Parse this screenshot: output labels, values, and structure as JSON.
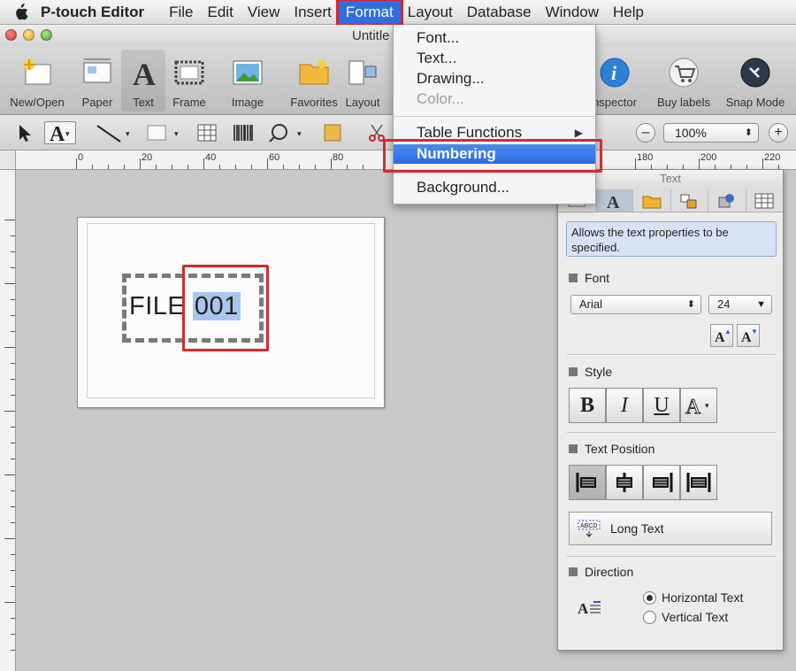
{
  "menubar": {
    "app_name": "P-touch Editor",
    "items": [
      "File",
      "Edit",
      "View",
      "Insert",
      "Format",
      "Layout",
      "Database",
      "Window",
      "Help"
    ],
    "active": "Format"
  },
  "window": {
    "title": "Untitle"
  },
  "toolbar": {
    "buttons": [
      {
        "label": "New/Open",
        "icon": "new-open-icon"
      },
      {
        "label": "Paper",
        "icon": "paper-icon"
      },
      {
        "label": "Text",
        "icon": "text-icon"
      },
      {
        "label": "Frame",
        "icon": "frame-icon"
      },
      {
        "label": "Image",
        "icon": "image-icon"
      },
      {
        "label": "Favorites",
        "icon": "favorites-icon"
      },
      {
        "label": "Layout",
        "icon": "layout-icon"
      },
      {
        "label": "nspector",
        "icon": "inspector-icon"
      },
      {
        "label": "Buy labels",
        "icon": "cart-icon"
      },
      {
        "label": "Snap Mode",
        "icon": "snap-mode-icon"
      }
    ]
  },
  "formatbar": {
    "zoom": "100%"
  },
  "ruler": {
    "labels": [
      "0",
      "20",
      "40",
      "60",
      "80",
      "180",
      "200",
      "220"
    ]
  },
  "format_menu": {
    "items": [
      {
        "label": "Font...",
        "state": "normal"
      },
      {
        "label": "Text...",
        "state": "normal"
      },
      {
        "label": "Drawing...",
        "state": "normal"
      },
      {
        "label": "Color...",
        "state": "disabled"
      },
      {
        "label": "Table Functions",
        "state": "submenu",
        "submenu_glyph": "▶"
      },
      {
        "label": "Numbering",
        "state": "selected"
      },
      {
        "label": "Background...",
        "state": "normal"
      }
    ]
  },
  "label": {
    "prefix": "FILE ",
    "number": "001"
  },
  "inspector": {
    "title": "Text",
    "description": "Allows the text properties to be specified.",
    "font": {
      "heading": "Font",
      "family": "Arial",
      "size": "24"
    },
    "style": {
      "heading": "Style",
      "bold": "B",
      "italic": "I",
      "underline": "U"
    },
    "text_position": {
      "heading": "Text Position",
      "long_text": "Long Text"
    },
    "direction": {
      "heading": "Direction",
      "options": [
        "Horizontal Text",
        "Vertical Text"
      ],
      "selected": "Horizontal Text"
    }
  },
  "colors": {
    "accent": "#2f6ee0",
    "highlight": "#d52a2e",
    "selection": "#a9c7ee"
  }
}
